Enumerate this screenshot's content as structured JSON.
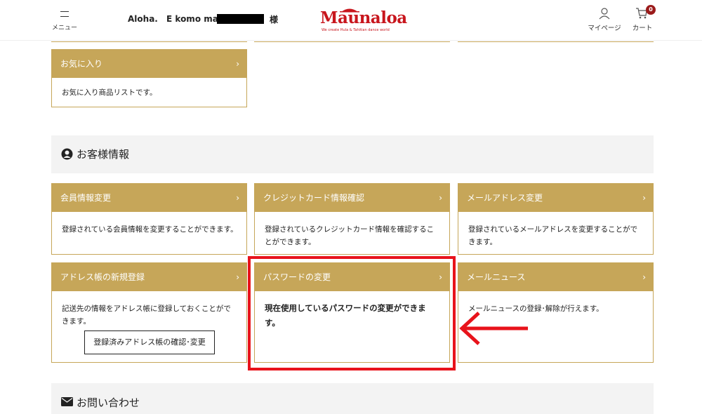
{
  "header": {
    "menu_label": "メニュー",
    "greeting": "Aloha.",
    "greeting2": "E komo mai.",
    "honorific": "様",
    "logo_text": "Maunaloa",
    "logo_tagline": "We create Hula & Tahitian dance world",
    "mypage_label": "マイページ",
    "cart_label": "カート",
    "cart_count": "0"
  },
  "favorites": {
    "title": "お気に入り",
    "desc": "お気に入り商品リストです。"
  },
  "customer_section": {
    "title": "お客様情報",
    "icon": "user-circle-icon"
  },
  "cards": [
    {
      "title": "会員情報変更",
      "desc": "登録されている会員情報を変更することができます。"
    },
    {
      "title": "クレジットカード情報確認",
      "desc": "登録されているクレジットカード情報を確認することができます。"
    },
    {
      "title": "メールアドレス変更",
      "desc": "登録されているメールアドレスを変更することができます。"
    },
    {
      "title": "アドレス帳の新規登録",
      "desc": "記送先の情報をアドレス帳に登録しておくことができます。",
      "button": "登録済みアドレス帳の確認･変更"
    },
    {
      "title": "パスワードの変更",
      "desc": "現在使用しているパスワードの変更ができます。"
    },
    {
      "title": "メールニュース",
      "desc": "メールニュースの登録･解除が行えます。"
    }
  ],
  "contact_section": {
    "title": "お問い合わせ",
    "icon": "envelope-icon"
  },
  "chevron": "›",
  "colors": {
    "gold": "#c6a659",
    "highlight_red": "#e8131b",
    "brand_red": "#c8161d",
    "badge": "#9b1b1b"
  }
}
